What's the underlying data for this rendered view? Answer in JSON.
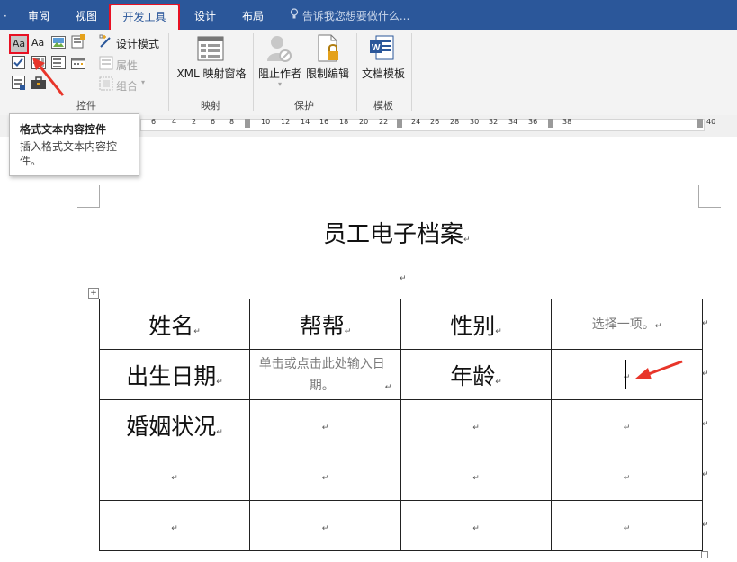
{
  "tabs": [
    {
      "label": "审阅"
    },
    {
      "label": "视图"
    },
    {
      "label": "开发工具"
    },
    {
      "label": "设计"
    },
    {
      "label": "布局"
    }
  ],
  "tell_me": {
    "placeholder": "告诉我您想要做什么..."
  },
  "ribbon": {
    "controls": {
      "group_label": "控件",
      "design_mode": "设计模式",
      "properties": "属性",
      "group": "组合"
    },
    "mapping": {
      "group_label": "映射",
      "xml_pane": "XML 映射窗格"
    },
    "protect": {
      "group_label": "保护",
      "block_authors": "阻止作者",
      "restrict_editing": "限制编辑"
    },
    "templates": {
      "group_label": "模板",
      "document_template": "文档模板"
    }
  },
  "tooltip": {
    "title": "格式文本内容控件",
    "description": "插入格式文本内容控件。"
  },
  "ruler": {
    "left_numbers": [
      "6",
      "4",
      "2",
      "2",
      "4",
      "6",
      "8"
    ],
    "right_numbers": [
      "10",
      "12",
      "14",
      "16",
      "18",
      "20",
      "22",
      "24",
      "26",
      "28",
      "30",
      "32",
      "34",
      "36",
      "38",
      "40"
    ]
  },
  "document": {
    "title": "员工电子档案",
    "paragraph_mark": "↵",
    "table": [
      [
        {
          "text": "姓名",
          "kind": "big"
        },
        {
          "text": "帮帮",
          "kind": "big"
        },
        {
          "text": "性别",
          "kind": "big"
        },
        {
          "text": "选择一项。",
          "kind": "ph"
        }
      ],
      [
        {
          "text": "出生日期",
          "kind": "big"
        },
        {
          "text": "单击或点击此处输入日期。",
          "kind": "ph"
        },
        {
          "text": "年龄",
          "kind": "big"
        },
        {
          "text": "",
          "kind": "caret"
        }
      ],
      [
        {
          "text": "婚姻状况",
          "kind": "big"
        },
        {
          "text": "",
          "kind": "empty"
        },
        {
          "text": "",
          "kind": "empty"
        },
        {
          "text": "",
          "kind": "empty"
        }
      ],
      [
        {
          "text": "",
          "kind": "empty"
        },
        {
          "text": "",
          "kind": "empty"
        },
        {
          "text": "",
          "kind": "empty"
        },
        {
          "text": "",
          "kind": "empty"
        }
      ],
      [
        {
          "text": "",
          "kind": "empty"
        },
        {
          "text": "",
          "kind": "empty"
        },
        {
          "text": "",
          "kind": "empty"
        },
        {
          "text": "",
          "kind": "empty"
        }
      ]
    ]
  },
  "colors": {
    "tabstrip": "#2b579a",
    "highlight": "#e81123",
    "annotation_arrow": "#e8352a"
  }
}
